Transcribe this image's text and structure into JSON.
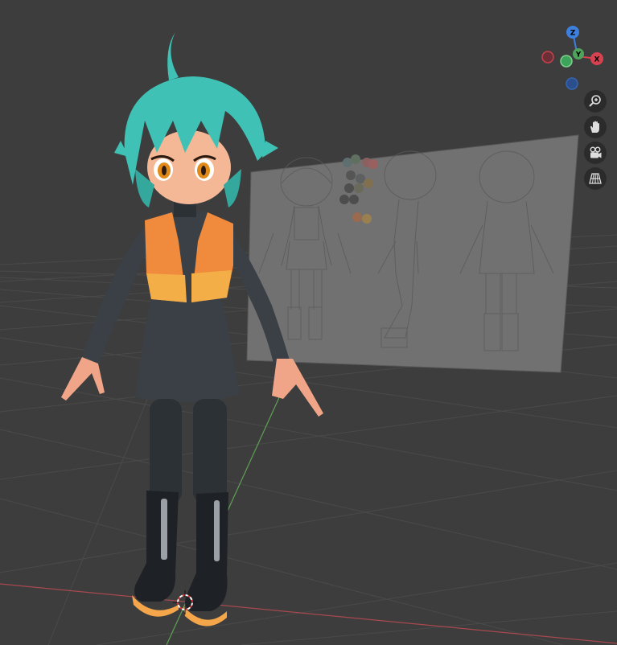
{
  "app": "Blender",
  "viewport": {
    "background_color": "#3d3d3d",
    "grid_line_color": "#4a4a4a",
    "x_axis_color": "#a8494f",
    "y_axis_color": "#5fa055"
  },
  "navigation_gizmo": {
    "axes": [
      {
        "label": "Z",
        "color": "#3d7fdc"
      },
      {
        "label": "Y",
        "color": "#4fa45c"
      },
      {
        "label": "X",
        "color": "#d84250"
      }
    ],
    "negative_axes": [
      {
        "axis": "-X",
        "color": "#c8404c"
      },
      {
        "axis": "-Y",
        "color": "#3ea35a"
      },
      {
        "axis": "-Z",
        "color": "#3566b5"
      }
    ]
  },
  "nav_tools": [
    {
      "icon": "zoom-magnifier-icon",
      "tooltip": ""
    },
    {
      "icon": "hand-pan-icon",
      "tooltip": ""
    },
    {
      "icon": "camera-view-icon",
      "tooltip": ""
    },
    {
      "icon": "perspective-grid-icon",
      "tooltip": ""
    }
  ],
  "scene_objects": [
    {
      "name": "character-model",
      "hair_color": "#3fc2b5",
      "vest_color": "#f08a3c",
      "dress_color": "#3a4046"
    },
    {
      "name": "reference-sheet",
      "color": "#707070"
    },
    {
      "name": "3d-cursor"
    }
  ]
}
